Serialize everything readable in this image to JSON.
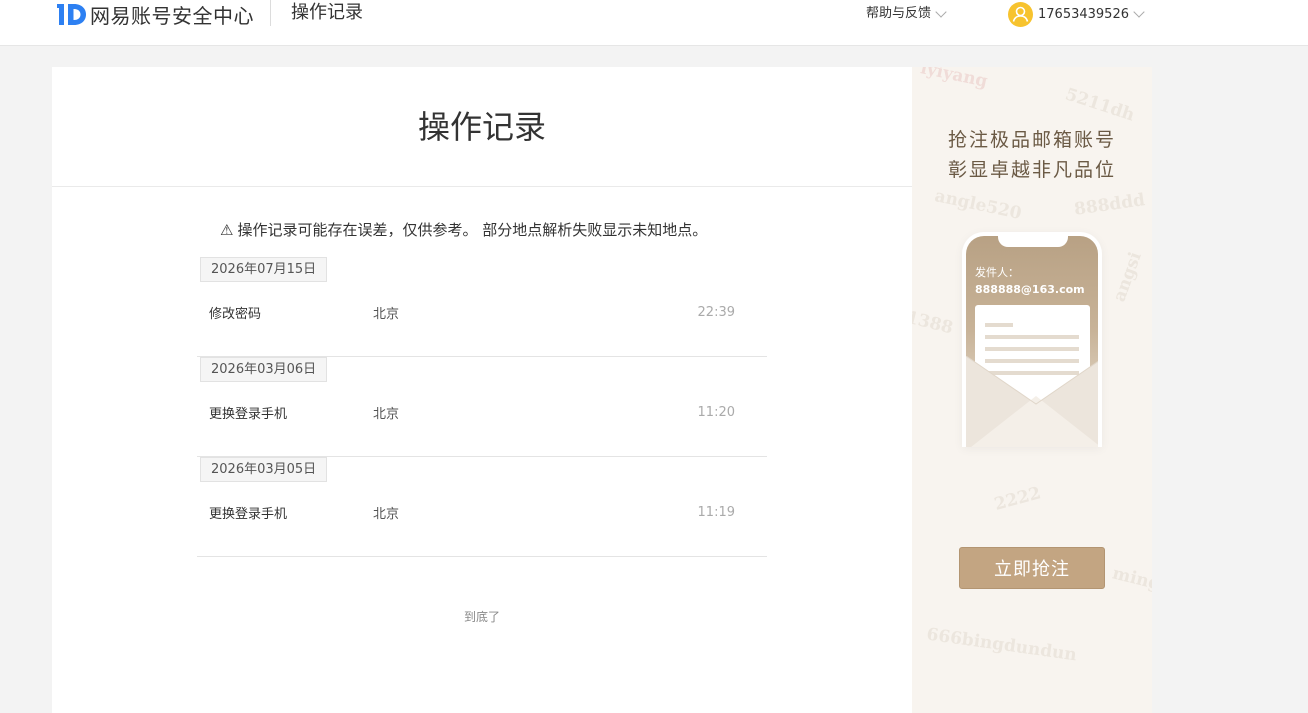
{
  "header": {
    "brand_name": "网易账号安全中心",
    "page_name": "操作记录",
    "help_label": "帮助与反馈",
    "user_phone": "17653439526"
  },
  "card": {
    "title": "操作记录",
    "notice": "操作记录可能存在误差，仅供参考。 部分地点解析失败显示未知地点。",
    "records": [
      {
        "date": "2026年07月15日",
        "action": "修改密码",
        "location": "北京",
        "time": "22:39"
      },
      {
        "date": "2026年03月06日",
        "action": "更换登录手机",
        "location": "北京",
        "time": "11:20"
      },
      {
        "date": "2026年03月05日",
        "action": "更换登录手机",
        "location": "北京",
        "time": "11:19"
      }
    ],
    "end_label": "到底了"
  },
  "ad": {
    "slogan_line1": "抢注极品邮箱账号",
    "slogan_line2": "彰显卓越非凡品位",
    "sender_label": "发件人：",
    "sender_email": "888888@163.com",
    "button_label": "立即抢注",
    "watermarks": [
      "5211dh",
      "angle520",
      "888ddd",
      "1388",
      "angsi",
      "2222",
      "ming",
      "666bingdundun",
      "iyiyang"
    ]
  },
  "colors": {
    "accent_blue": "#2d80f2",
    "avatar_yellow": "#f7c32e",
    "ad_gold": "#c3a582"
  }
}
